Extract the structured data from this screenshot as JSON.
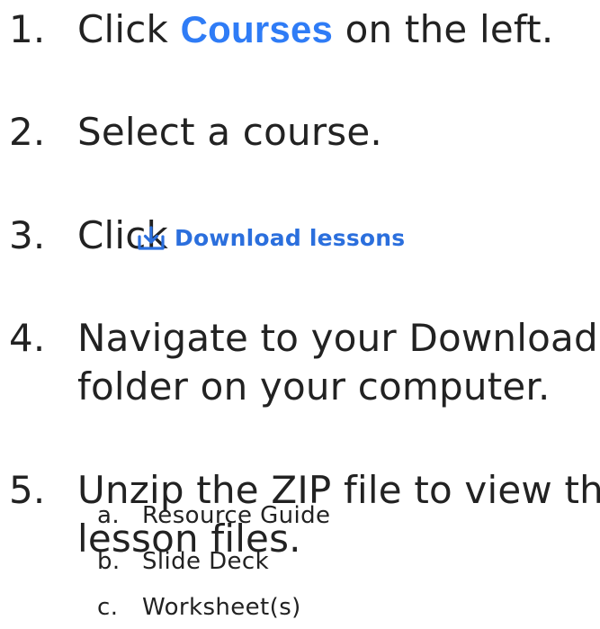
{
  "steps": [
    {
      "number": "1.",
      "pre": "Click ",
      "highlight": "Courses",
      "post": " on the left."
    },
    {
      "number": "2.",
      "text": "Select a course."
    },
    {
      "number": "3.",
      "text": "Click",
      "button": {
        "icon": "download-icon",
        "label": "Download lessons"
      }
    },
    {
      "number": "4.",
      "lines": [
        "Navigate to your Downloads",
        "folder on your computer."
      ]
    },
    {
      "number": "5.",
      "lines": [
        "Unzip the ZIP file to view the",
        "lesson files."
      ],
      "subitems": [
        {
          "letter": "a.",
          "text": "Resource Guide"
        },
        {
          "letter": "b.",
          "text": "Slide Deck"
        },
        {
          "letter": "c.",
          "text": "Worksheet(s)"
        }
      ]
    }
  ],
  "colors": {
    "text": "#222222",
    "courses_link": "#2f7cf6",
    "button_blue": "#2b6fdd"
  }
}
